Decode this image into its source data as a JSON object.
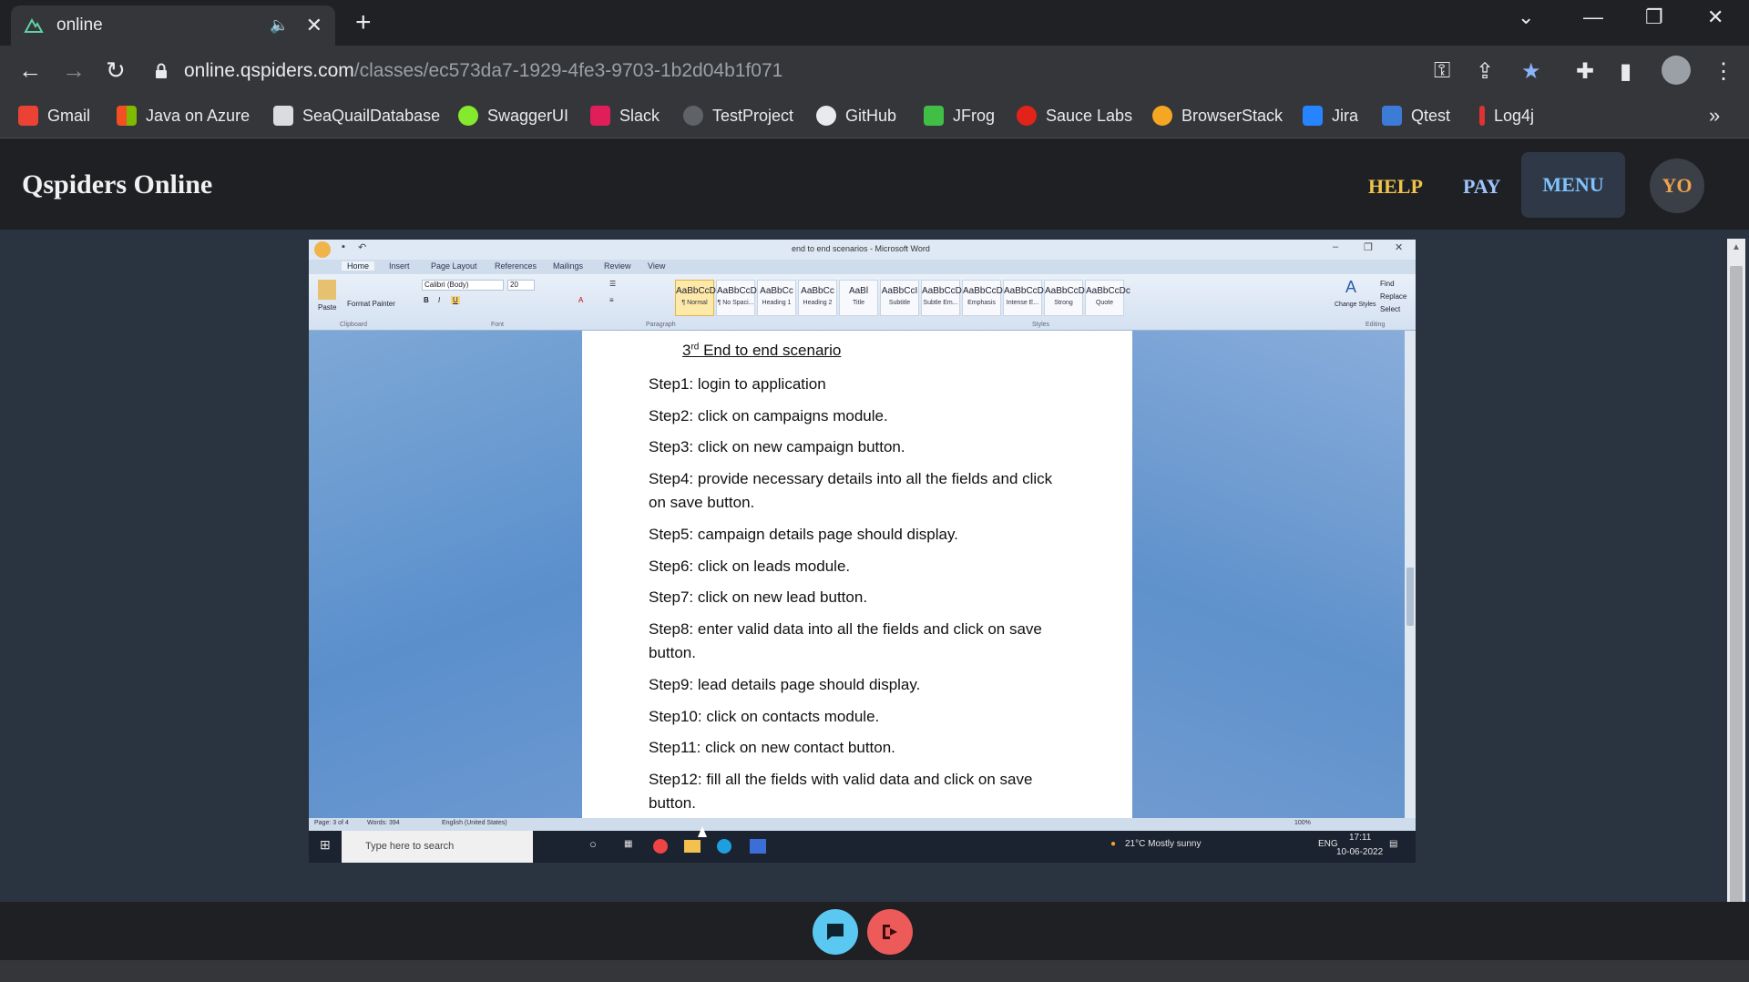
{
  "browser": {
    "tab_title": "online",
    "url_host": "online.qspiders.com",
    "url_path": "/classes/ec573da7-1929-4fe3-9703-1b2d04b1f071",
    "bookmarks": [
      "Gmail",
      "Java on Azure",
      "SeaQuailDatabase",
      "SwaggerUI",
      "Slack",
      "TestProject",
      "GitHub",
      "JFrog",
      "Sauce Labs",
      "BrowserStack",
      "Jira",
      "Qtest",
      "Log4j"
    ],
    "bookmark_more": "»"
  },
  "site": {
    "brand": "Qspiders Online",
    "nav_help": "HELP",
    "nav_pay": "PAY",
    "nav_menu": "MENU",
    "avatar": "YO"
  },
  "word": {
    "window_title": "end to end scenarios - Microsoft Word",
    "tabs": [
      "Home",
      "Insert",
      "Page Layout",
      "References",
      "Mailings",
      "Review",
      "View"
    ],
    "font_name": "Calibri (Body)",
    "font_size": "20",
    "paste_label": "Paste",
    "format_painter": "Format Painter",
    "styles": [
      {
        "sample": "AaBbCcDc",
        "name": "¶ Normal"
      },
      {
        "sample": "AaBbCcDc",
        "name": "¶ No Spaci..."
      },
      {
        "sample": "AaBbCc",
        "name": "Heading 1"
      },
      {
        "sample": "AaBbCc",
        "name": "Heading 2"
      },
      {
        "sample": "AaBl",
        "name": "Title"
      },
      {
        "sample": "AaBbCcI",
        "name": "Subtitle"
      },
      {
        "sample": "AaBbCcDc",
        "name": "Subtle Em..."
      },
      {
        "sample": "AaBbCcDc",
        "name": "Emphasis"
      },
      {
        "sample": "AaBbCcDc",
        "name": "Intense E..."
      },
      {
        "sample": "AaBbCcDc",
        "name": "Strong"
      },
      {
        "sample": "AaBbCcDc",
        "name": "Quote"
      }
    ],
    "change_styles": "Change Styles",
    "find": "Find",
    "replace": "Replace",
    "select": "Select",
    "groups": {
      "clipboard": "Clipboard",
      "font": "Font",
      "paragraph": "Paragraph",
      "styles": "Styles",
      "editing": "Editing"
    },
    "status": {
      "page": "Page: 3 of 4",
      "words": "Words: 394",
      "lang": "English (United States)",
      "zoom": "100%"
    },
    "doc_title_num": "3",
    "doc_title_sup": "rd",
    "doc_title_rest": " End to end scenario",
    "steps": [
      "Step1: login to application",
      "Step2: click on campaigns module.",
      "Step3: click on new campaign button.",
      "Step4: provide necessary details into all the fields and click on save button.",
      "Step5: campaign details page should display.",
      "Step6: click on leads module.",
      "Step7: click on new lead button.",
      "Step8: enter valid data into all the fields and click on save button.",
      "Step9: lead details page should display.",
      "Step10: click on contacts module.",
      "Step11: click on new contact button.",
      "Step12: fill all the fields with valid data and click on save button."
    ]
  },
  "taskbar": {
    "search_placeholder": "Type here to search",
    "weather": "21°C  Mostly sunny",
    "lang": "ENG",
    "time": "17:11",
    "date": "10-06-2022"
  }
}
